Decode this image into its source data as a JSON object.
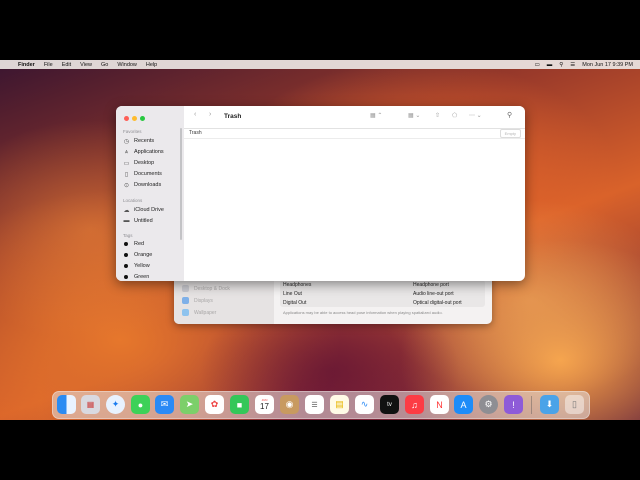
{
  "menubar": {
    "app": "Finder",
    "items": [
      "File",
      "Edit",
      "View",
      "Go",
      "Window",
      "Help"
    ],
    "datetime": "Mon Jun 17  9:39 PM"
  },
  "finder": {
    "title": "Trash",
    "path_label": "Trash",
    "empty_button": "Empty",
    "sidebar": {
      "favorites_header": "Favorites",
      "favorites": [
        {
          "label": "Recents",
          "icon": "clock-icon"
        },
        {
          "label": "Applications",
          "icon": "applications-icon"
        },
        {
          "label": "Desktop",
          "icon": "desktop-icon"
        },
        {
          "label": "Documents",
          "icon": "document-icon"
        },
        {
          "label": "Downloads",
          "icon": "downloads-icon"
        }
      ],
      "locations_header": "Locations",
      "locations": [
        {
          "label": "iCloud Drive",
          "icon": "cloud-icon"
        },
        {
          "label": "Untitled",
          "icon": "drive-icon"
        }
      ],
      "tags_header": "Tags",
      "tags": [
        {
          "label": "Red",
          "color": "#000000"
        },
        {
          "label": "Orange",
          "color": "#000000"
        },
        {
          "label": "Yellow",
          "color": "#000000"
        },
        {
          "label": "Green",
          "color": "#000000"
        }
      ]
    }
  },
  "settings": {
    "sidebar": [
      "Desktop & Dock",
      "Displays",
      "Wallpaper"
    ],
    "rows": [
      {
        "name": "Headphones",
        "type": "Headphone port"
      },
      {
        "name": "Line Out",
        "type": "Audio line-out port"
      },
      {
        "name": "Digital Out",
        "type": "Optical digital-out port"
      }
    ],
    "note": "Applications may be able to access head pose information when playing spatialized audio."
  },
  "dock": {
    "calendar": {
      "month": "JUN",
      "day": "17"
    },
    "apps": [
      "finder",
      "launchpad",
      "safari",
      "messages",
      "mail",
      "maps",
      "photos",
      "facetime",
      "calendar",
      "contacts",
      "reminders",
      "notes",
      "freeform",
      "tv",
      "music",
      "news",
      "app-store",
      "system-settings",
      "feedback",
      "downloads-folder",
      "trash"
    ]
  }
}
